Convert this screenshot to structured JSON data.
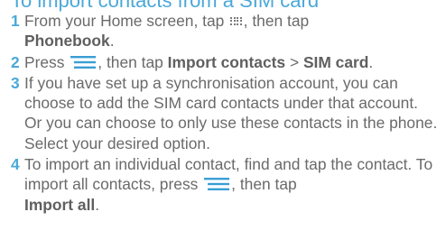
{
  "heading": "To import contacts from a SIM card",
  "steps": [
    {
      "num": "1",
      "t1": "From your Home screen, tap ",
      "icon": "apps-grid-icon",
      "t2": ", then tap",
      "b1": "Phonebook",
      "t3": "."
    },
    {
      "num": "2",
      "t1": "Press ",
      "icon": "menu-icon",
      "t2": ", then tap ",
      "b1": "Import contacts",
      "t3": " > ",
      "b2": "SIM card",
      "t4": "."
    },
    {
      "num": "3",
      "text": "If you have set up a synchronisation account, you can choose to add the SIM card contacts under that account. Or you can choose to only use these contacts in the phone. Select your desired option."
    },
    {
      "num": "4",
      "t1": "To import an individual contact, find and tap the contact. To import all contacts, press ",
      "icon": "menu-icon",
      "t2": ", then tap ",
      "b1": "Import all",
      "t3": "."
    }
  ],
  "colors": {
    "accent": "#4aa8d8",
    "text": "#6a6a6a"
  }
}
